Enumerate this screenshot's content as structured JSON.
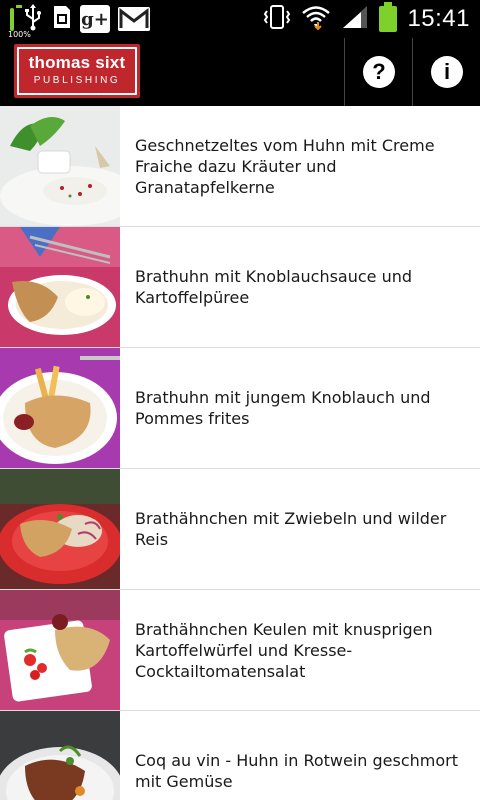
{
  "status_bar": {
    "battery_notification_label": "100%",
    "icons": [
      "battery-full-notification-icon",
      "usb-icon",
      "sd-card-icon",
      "google-plus-icon",
      "gmail-icon",
      "vibrate-icon",
      "wifi-icon",
      "signal-icon",
      "battery-icon"
    ],
    "gplus_label": "g+",
    "time": "15:41"
  },
  "app_bar": {
    "logo_line1": "thomas sixt",
    "logo_line2": "PUBLISHING",
    "help_icon_label": "?",
    "info_icon_label": "i",
    "brand_color": "#c0272d"
  },
  "recipes": [
    {
      "title": "Geschnetzeltes vom Huhn mit Creme Fraiche dazu Kräuter und Granatapfelkerne"
    },
    {
      "title": "Brathuhn mit Knoblauchsauce und Kartoffelpüree"
    },
    {
      "title": "Brathuhn mit jungem Knoblauch und Pommes frites"
    },
    {
      "title": "Brathähnchen mit Zwiebeln und wilder Reis"
    },
    {
      "title": "Brathähnchen Keulen mit knusprigen Kartoffelwürfel und Kresse-Cocktailtomatensalat"
    },
    {
      "title": "Coq au vin - Huhn in Rotwein geschmort mit Gemüse"
    }
  ]
}
